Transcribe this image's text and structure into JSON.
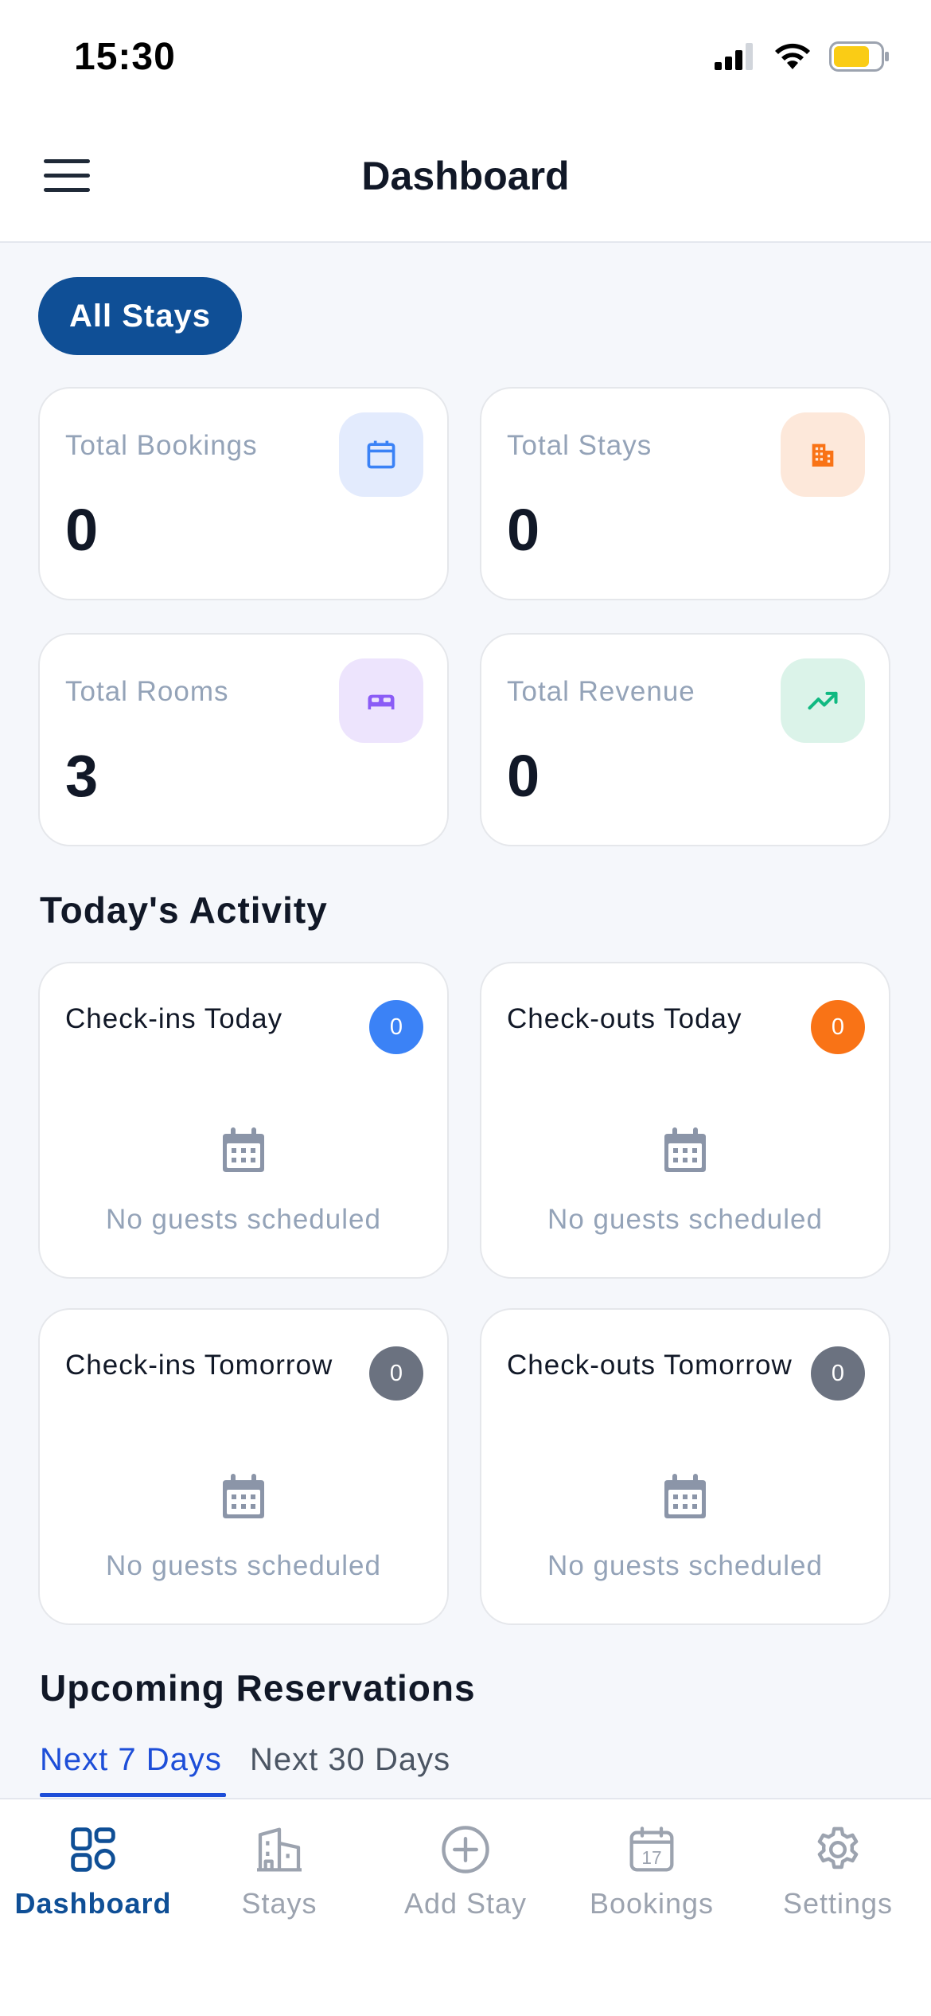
{
  "status_bar": {
    "time": "15:30"
  },
  "header": {
    "title": "Dashboard"
  },
  "filter": {
    "label": "All Stays"
  },
  "stats": [
    {
      "label": "Total Bookings",
      "value": "0",
      "icon": "calendar-icon",
      "icon_color": "#3b82f6",
      "icon_bg": "#e3ebfd"
    },
    {
      "label": "Total Stays",
      "value": "0",
      "icon": "building-icon",
      "icon_color": "#f97316",
      "icon_bg": "#fde8da"
    },
    {
      "label": "Total Rooms",
      "value": "3",
      "icon": "bed-icon",
      "icon_color": "#8b5cf6",
      "icon_bg": "#ede4fd"
    },
    {
      "label": "Total Revenue",
      "value": "0",
      "icon": "trending-up-icon",
      "icon_color": "#10b981",
      "icon_bg": "#dbf3e9"
    }
  ],
  "activity": {
    "title": "Today's Activity",
    "cards": [
      {
        "title": "Check-ins Today",
        "count": "0",
        "badge_color": "#3b82f6",
        "empty_text": "No guests scheduled"
      },
      {
        "title": "Check-outs Today",
        "count": "0",
        "badge_color": "#f97316",
        "empty_text": "No guests scheduled"
      },
      {
        "title": "Check-ins Tomorrow",
        "count": "0",
        "badge_color": "#6b7280",
        "empty_text": "No guests scheduled"
      },
      {
        "title": "Check-outs Tomorrow",
        "count": "0",
        "badge_color": "#6b7280",
        "empty_text": "No guests scheduled"
      }
    ]
  },
  "reservations": {
    "title": "Upcoming Reservations",
    "tabs": [
      {
        "label": "Next 7 Days",
        "active": true
      },
      {
        "label": "Next 30 Days",
        "active": false
      }
    ]
  },
  "bottom_nav": {
    "items": [
      {
        "label": "Dashboard",
        "icon": "dashboard-icon",
        "active": true
      },
      {
        "label": "Stays",
        "icon": "building-icon",
        "active": false
      },
      {
        "label": "Add Stay",
        "icon": "plus-circle-icon",
        "active": false
      },
      {
        "label": "Bookings",
        "icon": "calendar-17-icon",
        "active": false
      },
      {
        "label": "Settings",
        "icon": "gear-icon",
        "active": false
      }
    ],
    "calendar_day": "17"
  },
  "colors": {
    "accent": "#0f4f96",
    "active_tab": "#1d4ed8",
    "inactive": "#9ca3af"
  }
}
